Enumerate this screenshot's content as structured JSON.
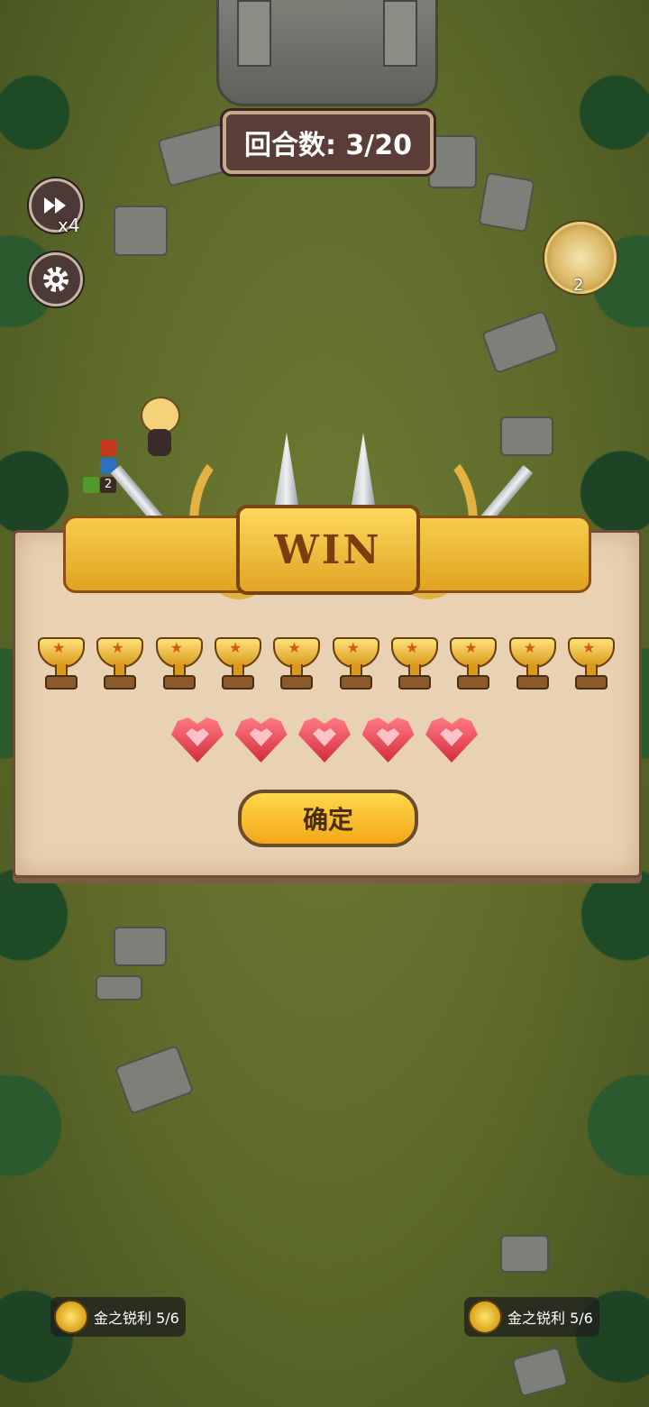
{
  "hud": {
    "round_label": "回合数: 3/20",
    "speed_label": "x4",
    "avatar_count": "2",
    "hero_level": "2"
  },
  "dialog": {
    "title": "WIN",
    "trophies": 10,
    "hearts": 5,
    "confirm_label": "确定"
  },
  "status": {
    "left": "金之锐利 5/6",
    "right": "金之锐利 5/6"
  },
  "icons": [
    "fast-forward-icon",
    "gear-icon",
    "trophy-icon",
    "heart-icon",
    "coin-icon"
  ]
}
